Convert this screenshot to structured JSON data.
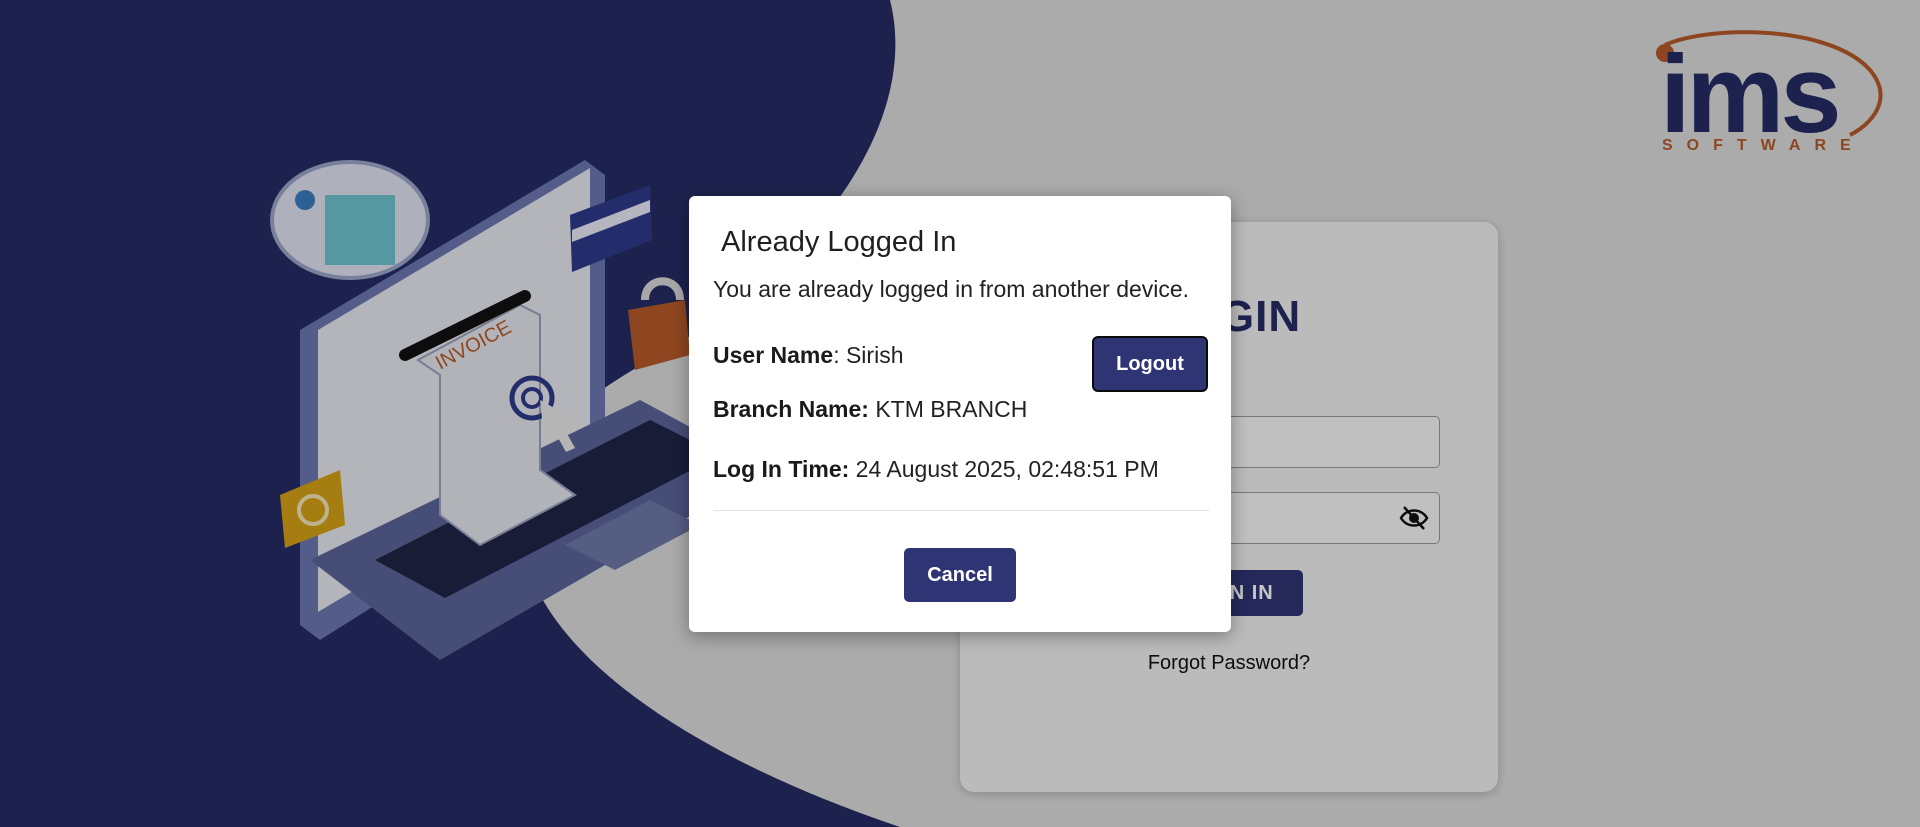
{
  "brand": {
    "logo_text": "ims",
    "logo_subtext": "SOFTWARE",
    "primary_color": "#252c63",
    "accent_color": "#b65a2a"
  },
  "illustration": {
    "invoice_label": "INVOICE"
  },
  "login_card": {
    "title": "LOGIN",
    "signin_label": "SIGN IN",
    "forgot_password_label": "Forgot Password?",
    "password_toggle_icon": "eye-slash-icon"
  },
  "modal": {
    "title": "Already Logged In",
    "message": "You are already logged in from another device.",
    "user_name_label": "User Name",
    "user_name_value": ": Sirish",
    "branch_name_label": "Branch Name:",
    "branch_name_value": " KTM BRANCH",
    "login_time_label": "Log In Time:",
    "login_time_value": " 24 August 2025, 02:48:51 PM",
    "logout_label": "Logout",
    "cancel_label": "Cancel"
  }
}
